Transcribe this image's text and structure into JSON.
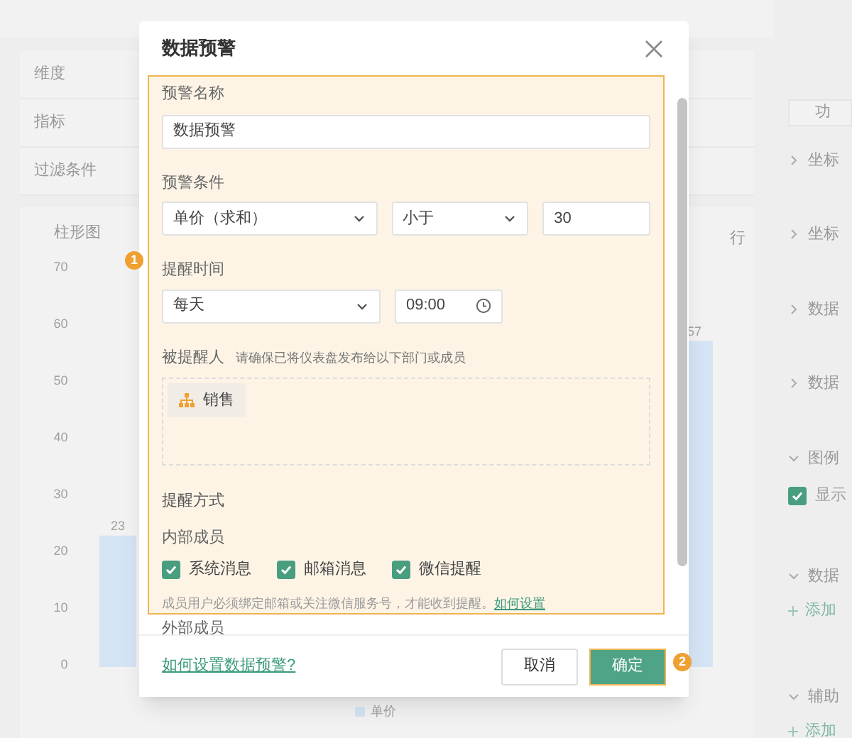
{
  "background": {
    "filters": [
      {
        "label": "维度"
      },
      {
        "label": "指标"
      },
      {
        "label": "过滤条件"
      }
    ],
    "chart": {
      "label_right": "行",
      "chart_data": {
        "type": "bar",
        "title": "柱形图",
        "yticks": [
          0,
          10,
          20,
          30,
          40,
          50,
          60,
          70
        ],
        "ylim": [
          0,
          70
        ],
        "series": [
          {
            "name": "单价",
            "color": "#d4e4f4",
            "values": [
              23,
              57
            ]
          }
        ],
        "data_labels": true
      }
    },
    "right_panel": {
      "button": "功",
      "sections": [
        {
          "label": "坐标",
          "expanded": false
        },
        {
          "label": "坐标",
          "expanded": false
        },
        {
          "label": "数据",
          "expanded": false
        },
        {
          "label": "数据",
          "expanded": false
        },
        {
          "label": "图例",
          "expanded": true
        },
        {
          "label": "数据",
          "expanded": true
        },
        {
          "label": "辅助",
          "expanded": true
        }
      ],
      "legend_checkbox": {
        "label": "显示",
        "checked": true
      },
      "add_links": [
        "添加",
        "添加"
      ]
    }
  },
  "dialog": {
    "title": "数据预警",
    "name_field": {
      "label": "预警名称",
      "value": "数据预警"
    },
    "condition": {
      "label": "预警条件",
      "field": "单价（求和）",
      "operator": "小于",
      "value": "30"
    },
    "time": {
      "label": "提醒时间",
      "frequency": "每天",
      "clock": "09:00"
    },
    "recipients": {
      "label": "被提醒人",
      "hint": "请确保已将仪表盘发布给以下部门或成员",
      "items": [
        {
          "name": "销售"
        }
      ]
    },
    "method": {
      "label": "提醒方式",
      "group": "内部成员",
      "options": [
        {
          "label": "系统消息",
          "checked": true
        },
        {
          "label": "邮箱消息",
          "checked": true
        },
        {
          "label": "微信提醒",
          "checked": true
        }
      ],
      "note": "成员用户必须绑定邮箱或关注微信服务号，才能收到提醒。",
      "note_link": "如何设置",
      "external": "外部成员"
    },
    "help_link": "如何设置数据预警?",
    "buttons": [
      {
        "label": "取消",
        "kind": "secondary"
      },
      {
        "label": "确定",
        "kind": "primary"
      }
    ]
  },
  "annotations": [
    "1",
    "2"
  ]
}
